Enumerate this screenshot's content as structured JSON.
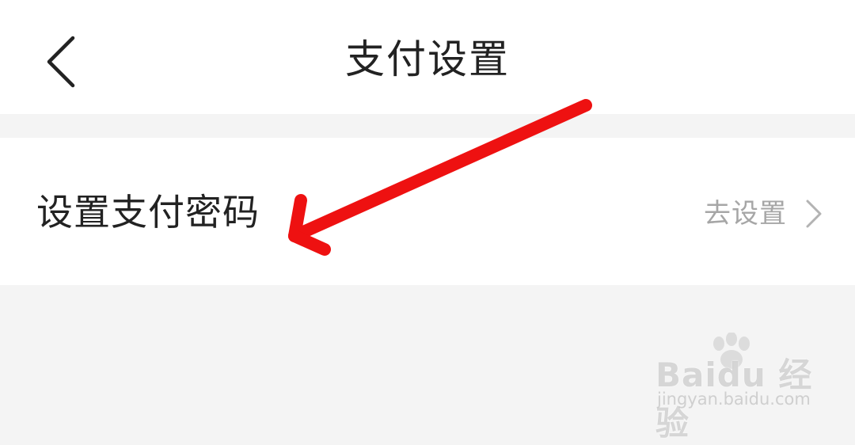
{
  "header": {
    "title": "支付设置",
    "back_icon": "chevron-left-icon"
  },
  "settings": {
    "items": [
      {
        "label": "设置支付密码",
        "action_label": "去设置",
        "action_icon": "chevron-right-icon"
      }
    ]
  },
  "annotation": {
    "arrow_color": "#ee1111"
  },
  "watermark": {
    "logo_text": "Baidu 经验",
    "url": "jingyan.baidu.com"
  },
  "colors": {
    "page_background": "#f4f4f4",
    "card_background": "#ffffff",
    "primary_text": "#222222",
    "secondary_text": "#a6a6a6"
  }
}
